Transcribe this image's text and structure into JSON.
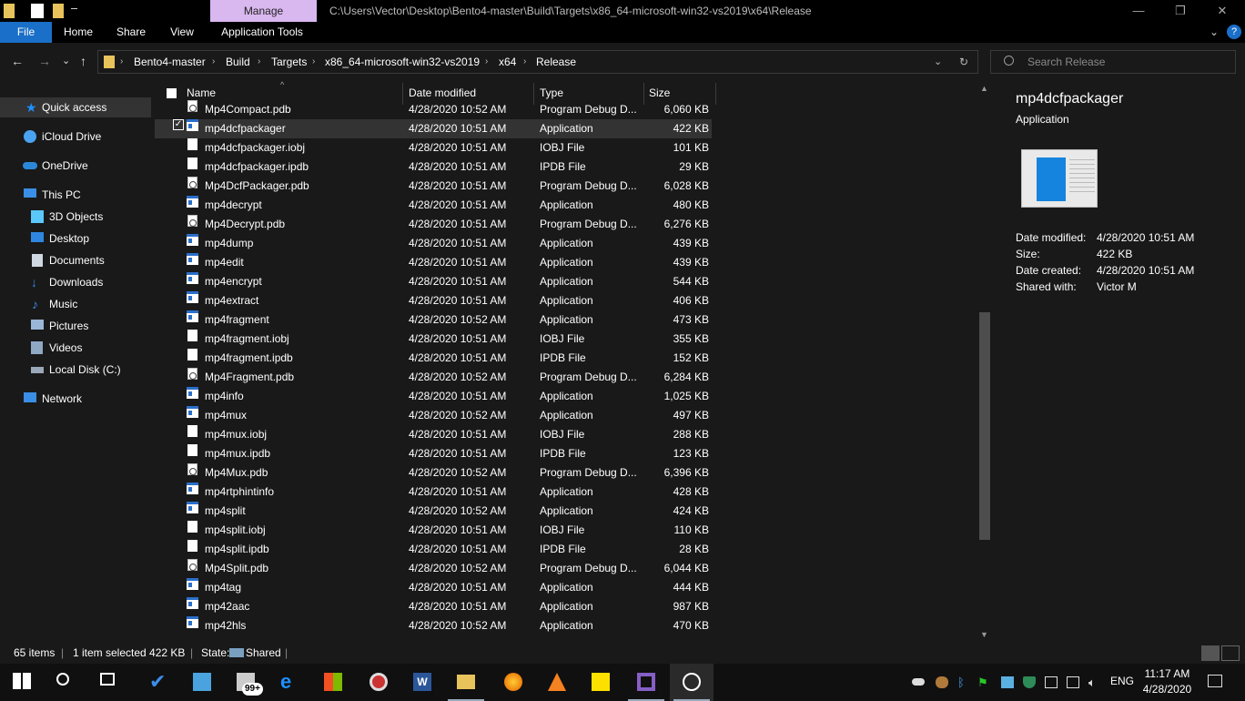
{
  "titlebar": {
    "manage_tab": "Manage",
    "path": "C:\\Users\\Vector\\Desktop\\Bento4-master\\Build\\Targets\\x86_64-microsoft-win32-vs2019\\x64\\Release",
    "minimize": "—",
    "maximize": "❐",
    "close": "✕"
  },
  "ribbon": {
    "tabs": [
      "File",
      "Home",
      "Share",
      "View",
      "Application Tools"
    ],
    "collapse": "⌄",
    "help": "?"
  },
  "nav": {
    "back": "←",
    "forward": "→",
    "recent": "⌄",
    "up": "↑",
    "breadcrumbs": [
      "Bento4-master",
      "Build",
      "Targets",
      "x86_64-microsoft-win32-vs2019",
      "x64",
      "Release"
    ],
    "search_placeholder": "Search Release"
  },
  "sidebar": {
    "items": [
      {
        "label": "Quick access",
        "icon": "star-icon",
        "color": "#1e90ff"
      },
      {
        "label": "iCloud Drive",
        "icon": "icloud-icon",
        "color": "#4aa3f0"
      },
      {
        "label": "OneDrive",
        "icon": "onedrive-icon",
        "color": "#2b88d8"
      },
      {
        "label": "This PC",
        "icon": "pc-icon",
        "color": "#3a8ee6"
      },
      {
        "label": "3D Objects",
        "icon": "cube-icon",
        "color": "#5ac8fa"
      },
      {
        "label": "Desktop",
        "icon": "desktop-icon",
        "color": "#2f86e0"
      },
      {
        "label": "Documents",
        "icon": "documents-icon",
        "color": "#cfd8e0"
      },
      {
        "label": "Downloads",
        "icon": "download-icon",
        "color": "#2f86e0"
      },
      {
        "label": "Music",
        "icon": "music-icon",
        "color": "#3b8ee8"
      },
      {
        "label": "Pictures",
        "icon": "pictures-icon",
        "color": "#9ab6d6"
      },
      {
        "label": "Videos",
        "icon": "videos-icon",
        "color": "#8fa8c4"
      },
      {
        "label": "Local Disk (C:)",
        "icon": "disk-icon",
        "color": "#9aa8b8"
      },
      {
        "label": "Network",
        "icon": "network-icon",
        "color": "#3a8ee6"
      }
    ]
  },
  "columns": {
    "name": "Name",
    "date": "Date modified",
    "type": "Type",
    "size": "Size"
  },
  "files": [
    {
      "name": "Mp4Compact.pdb",
      "date": "4/28/2020 10:52 AM",
      "type": "Program Debug D...",
      "size": "6,060 KB",
      "kind": "pdb"
    },
    {
      "name": "mp4dcfpackager",
      "date": "4/28/2020 10:51 AM",
      "type": "Application",
      "size": "422 KB",
      "kind": "app",
      "selected": true
    },
    {
      "name": "mp4dcfpackager.iobj",
      "date": "4/28/2020 10:51 AM",
      "type": "IOBJ File",
      "size": "101 KB",
      "kind": "doc"
    },
    {
      "name": "mp4dcfpackager.ipdb",
      "date": "4/28/2020 10:51 AM",
      "type": "IPDB File",
      "size": "29 KB",
      "kind": "doc"
    },
    {
      "name": "Mp4DcfPackager.pdb",
      "date": "4/28/2020 10:51 AM",
      "type": "Program Debug D...",
      "size": "6,028 KB",
      "kind": "pdb"
    },
    {
      "name": "mp4decrypt",
      "date": "4/28/2020 10:51 AM",
      "type": "Application",
      "size": "480 KB",
      "kind": "app"
    },
    {
      "name": "Mp4Decrypt.pdb",
      "date": "4/28/2020 10:51 AM",
      "type": "Program Debug D...",
      "size": "6,276 KB",
      "kind": "pdb"
    },
    {
      "name": "mp4dump",
      "date": "4/28/2020 10:51 AM",
      "type": "Application",
      "size": "439 KB",
      "kind": "app"
    },
    {
      "name": "mp4edit",
      "date": "4/28/2020 10:51 AM",
      "type": "Application",
      "size": "439 KB",
      "kind": "app"
    },
    {
      "name": "mp4encrypt",
      "date": "4/28/2020 10:51 AM",
      "type": "Application",
      "size": "544 KB",
      "kind": "app"
    },
    {
      "name": "mp4extract",
      "date": "4/28/2020 10:51 AM",
      "type": "Application",
      "size": "406 KB",
      "kind": "app"
    },
    {
      "name": "mp4fragment",
      "date": "4/28/2020 10:52 AM",
      "type": "Application",
      "size": "473 KB",
      "kind": "app"
    },
    {
      "name": "mp4fragment.iobj",
      "date": "4/28/2020 10:51 AM",
      "type": "IOBJ File",
      "size": "355 KB",
      "kind": "doc"
    },
    {
      "name": "mp4fragment.ipdb",
      "date": "4/28/2020 10:51 AM",
      "type": "IPDB File",
      "size": "152 KB",
      "kind": "doc"
    },
    {
      "name": "Mp4Fragment.pdb",
      "date": "4/28/2020 10:52 AM",
      "type": "Program Debug D...",
      "size": "6,284 KB",
      "kind": "pdb"
    },
    {
      "name": "mp4info",
      "date": "4/28/2020 10:51 AM",
      "type": "Application",
      "size": "1,025 KB",
      "kind": "app"
    },
    {
      "name": "mp4mux",
      "date": "4/28/2020 10:52 AM",
      "type": "Application",
      "size": "497 KB",
      "kind": "app"
    },
    {
      "name": "mp4mux.iobj",
      "date": "4/28/2020 10:51 AM",
      "type": "IOBJ File",
      "size": "288 KB",
      "kind": "doc"
    },
    {
      "name": "mp4mux.ipdb",
      "date": "4/28/2020 10:51 AM",
      "type": "IPDB File",
      "size": "123 KB",
      "kind": "doc"
    },
    {
      "name": "Mp4Mux.pdb",
      "date": "4/28/2020 10:52 AM",
      "type": "Program Debug D...",
      "size": "6,396 KB",
      "kind": "pdb"
    },
    {
      "name": "mp4rtphintinfo",
      "date": "4/28/2020 10:51 AM",
      "type": "Application",
      "size": "428 KB",
      "kind": "app"
    },
    {
      "name": "mp4split",
      "date": "4/28/2020 10:52 AM",
      "type": "Application",
      "size": "424 KB",
      "kind": "app"
    },
    {
      "name": "mp4split.iobj",
      "date": "4/28/2020 10:51 AM",
      "type": "IOBJ File",
      "size": "110 KB",
      "kind": "doc"
    },
    {
      "name": "mp4split.ipdb",
      "date": "4/28/2020 10:51 AM",
      "type": "IPDB File",
      "size": "28 KB",
      "kind": "doc"
    },
    {
      "name": "Mp4Split.pdb",
      "date": "4/28/2020 10:52 AM",
      "type": "Program Debug D...",
      "size": "6,044 KB",
      "kind": "pdb"
    },
    {
      "name": "mp4tag",
      "date": "4/28/2020 10:51 AM",
      "type": "Application",
      "size": "444 KB",
      "kind": "app"
    },
    {
      "name": "mp42aac",
      "date": "4/28/2020 10:51 AM",
      "type": "Application",
      "size": "987 KB",
      "kind": "app"
    },
    {
      "name": "mp42hls",
      "date": "4/28/2020 10:52 AM",
      "type": "Application",
      "size": "470 KB",
      "kind": "app"
    }
  ],
  "preview": {
    "name": "mp4dcfpackager",
    "type": "Application",
    "details": [
      {
        "label": "Date modified:",
        "value": "4/28/2020 10:51 AM"
      },
      {
        "label": "Size:",
        "value": "422 KB"
      },
      {
        "label": "Date created:",
        "value": "4/28/2020 10:51 AM"
      },
      {
        "label": "Shared with:",
        "value": "Victor M"
      }
    ]
  },
  "status": {
    "items": "65 items",
    "selected": "1 item selected  422 KB",
    "state_label": "State:",
    "state_value": "Shared"
  },
  "taskbar": {
    "apps": [
      "start-icon",
      "search-icon",
      "task-view-icon",
      "todo-icon",
      "control-panel-icon",
      "mail-icon",
      "edge-icon",
      "store-icon",
      "media-player-icon",
      "word-icon",
      "file-explorer-icon",
      "firefox-icon",
      "vlc-icon",
      "sticky-notes-icon",
      "visual-studio-icon",
      "photos-icon"
    ],
    "mail_badge": "99+",
    "lang": "ENG",
    "time": "11:17 AM",
    "date": "4/28/2020",
    "accent": "#1a6fc8"
  }
}
